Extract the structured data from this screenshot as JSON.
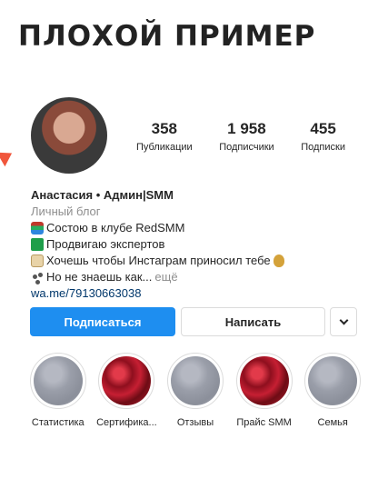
{
  "banner": {
    "title": "ПЛОХОЙ ПРИМЕР"
  },
  "profile": {
    "stats": [
      {
        "value": "358",
        "label": "Публикации"
      },
      {
        "value": "1 958",
        "label": "Подписчики"
      },
      {
        "value": "455",
        "label": "Подписки"
      }
    ],
    "name": "Анастасия • Админ|SMM",
    "category": "Личный блог",
    "bio_lines": [
      {
        "icon": "books-icon",
        "text": "Состою в клубе RedSMM"
      },
      {
        "icon": "recycle-icon",
        "text": "Продвигаю экспертов"
      },
      {
        "icon": "scroll-icon",
        "text": "Хочешь чтобы Инстаграм приносил тебе"
      },
      {
        "icon": "paw-prints-icon",
        "text": "Но не знаешь как..."
      }
    ],
    "more_label": "ещё",
    "link": "wa.me/79130663038"
  },
  "actions": {
    "follow_label": "Подписаться",
    "message_label": "Написать"
  },
  "highlights": [
    {
      "label": "Статистика",
      "cover": "gray"
    },
    {
      "label": "Сертифика...",
      "cover": "red"
    },
    {
      "label": "Отзывы",
      "cover": "gray"
    },
    {
      "label": "Прайс SMM",
      "cover": "red"
    },
    {
      "label": "Семья",
      "cover": "gray"
    }
  ],
  "colors": {
    "accent": "#1e8ef0",
    "link": "#00376b",
    "arrow": "#f0563c"
  }
}
